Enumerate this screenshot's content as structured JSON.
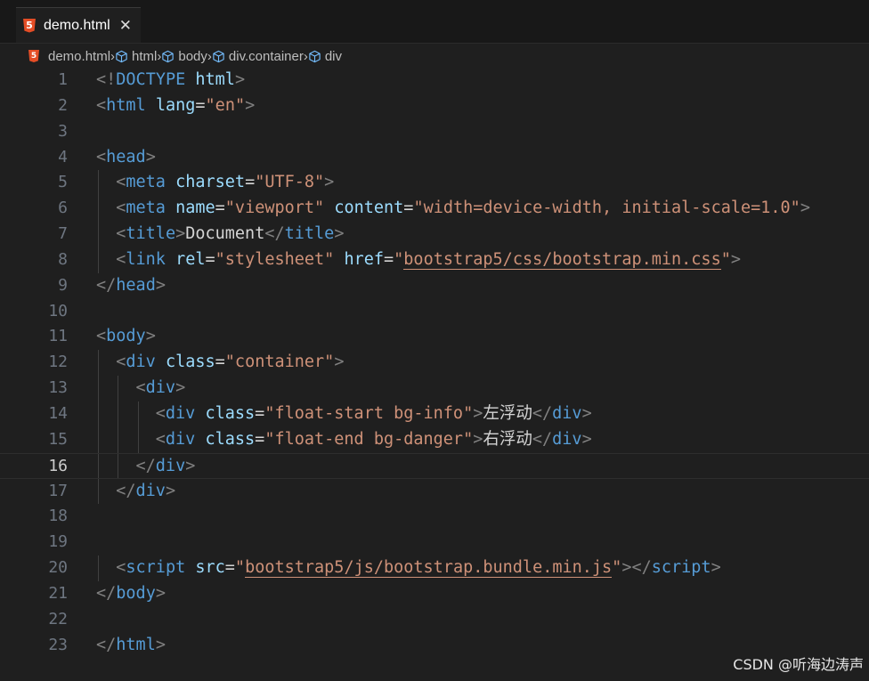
{
  "tab": {
    "file_icon": "html5-icon",
    "title": "demo.html",
    "close_icon": "close-icon",
    "close_glyph": "✕"
  },
  "breadcrumb": [
    {
      "label": "demo.html",
      "icon": "html5-icon"
    },
    {
      "label": "html",
      "icon": "cube-icon"
    },
    {
      "label": "body",
      "icon": "cube-icon"
    },
    {
      "label": "div.container",
      "icon": "cube-icon"
    },
    {
      "label": "div",
      "icon": "cube-icon"
    }
  ],
  "breadcrumb_separator": "›",
  "editor": {
    "current_line": 16,
    "lines": [
      {
        "n": "1",
        "indent": 0,
        "tokens": [
          [
            "bracket",
            "<!"
          ],
          [
            "tag",
            "DOCTYPE "
          ],
          [
            "attr",
            "html"
          ],
          [
            "bracket",
            ">"
          ]
        ]
      },
      {
        "n": "2",
        "indent": 0,
        "tokens": [
          [
            "bracket",
            "<"
          ],
          [
            "tag",
            "html"
          ],
          [
            "text",
            " "
          ],
          [
            "attr",
            "lang"
          ],
          [
            "text",
            "="
          ],
          [
            "str",
            "\"en\""
          ],
          [
            "bracket",
            ">"
          ]
        ]
      },
      {
        "n": "3",
        "indent": 0,
        "tokens": []
      },
      {
        "n": "4",
        "indent": 0,
        "tokens": [
          [
            "bracket",
            "<"
          ],
          [
            "tag",
            "head"
          ],
          [
            "bracket",
            ">"
          ]
        ]
      },
      {
        "n": "5",
        "indent": 1,
        "tokens": [
          [
            "bracket",
            "<"
          ],
          [
            "tag",
            "meta"
          ],
          [
            "text",
            " "
          ],
          [
            "attr",
            "charset"
          ],
          [
            "text",
            "="
          ],
          [
            "str",
            "\"UTF-8\""
          ],
          [
            "bracket",
            ">"
          ]
        ]
      },
      {
        "n": "6",
        "indent": 1,
        "tokens": [
          [
            "bracket",
            "<"
          ],
          [
            "tag",
            "meta"
          ],
          [
            "text",
            " "
          ],
          [
            "attr",
            "name"
          ],
          [
            "text",
            "="
          ],
          [
            "str",
            "\"viewport\""
          ],
          [
            "text",
            " "
          ],
          [
            "attr",
            "content"
          ],
          [
            "text",
            "="
          ],
          [
            "str",
            "\"width=device-width, initial-scale=1.0\""
          ],
          [
            "bracket",
            ">"
          ]
        ]
      },
      {
        "n": "7",
        "indent": 1,
        "tokens": [
          [
            "bracket",
            "<"
          ],
          [
            "tag",
            "title"
          ],
          [
            "bracket",
            ">"
          ],
          [
            "text",
            "Document"
          ],
          [
            "bracket",
            "</"
          ],
          [
            "tag",
            "title"
          ],
          [
            "bracket",
            ">"
          ]
        ]
      },
      {
        "n": "8",
        "indent": 1,
        "tokens": [
          [
            "bracket",
            "<"
          ],
          [
            "tag",
            "link"
          ],
          [
            "text",
            " "
          ],
          [
            "attr",
            "rel"
          ],
          [
            "text",
            "="
          ],
          [
            "str",
            "\"stylesheet\""
          ],
          [
            "text",
            " "
          ],
          [
            "attr",
            "href"
          ],
          [
            "text",
            "="
          ],
          [
            "str",
            "\""
          ],
          [
            "link",
            "bootstrap5/css/bootstrap.min.css"
          ],
          [
            "str",
            "\""
          ],
          [
            "bracket",
            ">"
          ]
        ]
      },
      {
        "n": "9",
        "indent": 0,
        "tokens": [
          [
            "bracket",
            "</"
          ],
          [
            "tag",
            "head"
          ],
          [
            "bracket",
            ">"
          ]
        ]
      },
      {
        "n": "10",
        "indent": 0,
        "tokens": []
      },
      {
        "n": "11",
        "indent": 0,
        "tokens": [
          [
            "bracket",
            "<"
          ],
          [
            "tag",
            "body"
          ],
          [
            "bracket",
            ">"
          ]
        ]
      },
      {
        "n": "12",
        "indent": 1,
        "tokens": [
          [
            "bracket",
            "<"
          ],
          [
            "tag",
            "div"
          ],
          [
            "text",
            " "
          ],
          [
            "attr",
            "class"
          ],
          [
            "text",
            "="
          ],
          [
            "str",
            "\"container\""
          ],
          [
            "bracket",
            ">"
          ]
        ]
      },
      {
        "n": "13",
        "indent": 2,
        "tokens": [
          [
            "bracket",
            "<"
          ],
          [
            "tag",
            "div"
          ],
          [
            "bracket",
            ">"
          ]
        ]
      },
      {
        "n": "14",
        "indent": 3,
        "tokens": [
          [
            "bracket",
            "<"
          ],
          [
            "tag",
            "div"
          ],
          [
            "text",
            " "
          ],
          [
            "attr",
            "class"
          ],
          [
            "text",
            "="
          ],
          [
            "str",
            "\"float-start bg-info\""
          ],
          [
            "bracket",
            ">"
          ],
          [
            "text",
            "左浮动"
          ],
          [
            "bracket",
            "</"
          ],
          [
            "tag",
            "div"
          ],
          [
            "bracket",
            ">"
          ]
        ]
      },
      {
        "n": "15",
        "indent": 3,
        "tokens": [
          [
            "bracket",
            "<"
          ],
          [
            "tag",
            "div"
          ],
          [
            "text",
            " "
          ],
          [
            "attr",
            "class"
          ],
          [
            "text",
            "="
          ],
          [
            "str",
            "\"float-end bg-danger\""
          ],
          [
            "bracket",
            ">"
          ],
          [
            "text",
            "右浮动"
          ],
          [
            "bracket",
            "</"
          ],
          [
            "tag",
            "div"
          ],
          [
            "bracket",
            ">"
          ]
        ]
      },
      {
        "n": "16",
        "indent": 2,
        "tokens": [
          [
            "bracket",
            "</"
          ],
          [
            "tag",
            "div"
          ],
          [
            "bracket",
            ">"
          ]
        ]
      },
      {
        "n": "17",
        "indent": 1,
        "tokens": [
          [
            "bracket",
            "</"
          ],
          [
            "tag",
            "div"
          ],
          [
            "bracket",
            ">"
          ]
        ]
      },
      {
        "n": "18",
        "indent": 0,
        "tokens": []
      },
      {
        "n": "19",
        "indent": 0,
        "tokens": []
      },
      {
        "n": "20",
        "indent": 1,
        "tokens": [
          [
            "bracket",
            "<"
          ],
          [
            "tag",
            "script"
          ],
          [
            "text",
            " "
          ],
          [
            "attr",
            "src"
          ],
          [
            "text",
            "="
          ],
          [
            "str",
            "\""
          ],
          [
            "link",
            "bootstrap5/js/bootstrap.bundle.min.js"
          ],
          [
            "str",
            "\""
          ],
          [
            "bracket",
            "></"
          ],
          [
            "tag",
            "script"
          ],
          [
            "bracket",
            ">"
          ]
        ]
      },
      {
        "n": "21",
        "indent": 0,
        "tokens": [
          [
            "bracket",
            "</"
          ],
          [
            "tag",
            "body"
          ],
          [
            "bracket",
            ">"
          ]
        ]
      },
      {
        "n": "22",
        "indent": 0,
        "tokens": []
      },
      {
        "n": "23",
        "indent": 0,
        "tokens": [
          [
            "bracket",
            "</"
          ],
          [
            "tag",
            "html"
          ],
          [
            "bracket",
            ">"
          ]
        ]
      }
    ]
  },
  "watermark": "CSDN @听海边涛声",
  "colors": {
    "background": "#1f1f1f",
    "tag": "#569cd6",
    "attribute": "#9cdcfe",
    "string": "#ce9178",
    "bracket": "#808080",
    "text": "#d4d4d4",
    "line_number": "#6e7681"
  }
}
